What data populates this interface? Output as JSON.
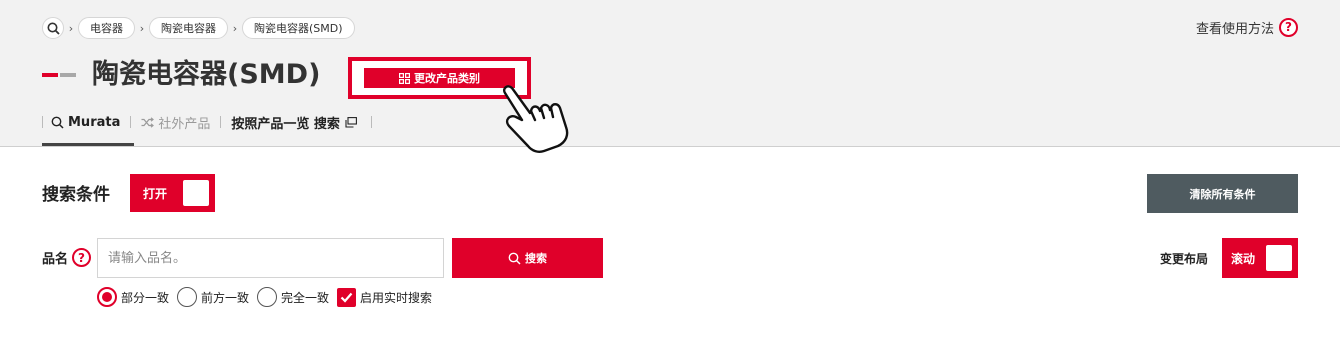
{
  "breadcrumb": {
    "home_icon": "search-icon",
    "items": [
      "电容器",
      "陶瓷电容器",
      "陶瓷电容器(SMD)"
    ]
  },
  "help": {
    "label": "查看使用方法",
    "icon": "question-mark-icon",
    "symbol": "?"
  },
  "title": {
    "text": "陶瓷电容器(SMD)"
  },
  "change_category": {
    "label": "更改产品类别",
    "icon": "grid-icon"
  },
  "tabs": {
    "murata": "Murata",
    "other": "社外产品",
    "list_search": "按照产品一览 搜索"
  },
  "search": {
    "section_title": "搜索条件",
    "toggle_label": "打开",
    "clear_label": "清除所有条件",
    "name_label": "品名",
    "placeholder": "请输入品名。",
    "search_label": "搜索",
    "options": [
      "部分一致",
      "前方一致",
      "完全一致"
    ],
    "selected_option": "部分一致",
    "realtime_label": "启用实时搜索",
    "realtime_checked": true
  },
  "layout": {
    "label": "变更布局",
    "toggle_label": "滚动"
  },
  "colors": {
    "accent": "#e0002a",
    "dark_button": "#4f5b60",
    "header_bg": "#f2f2f2"
  }
}
